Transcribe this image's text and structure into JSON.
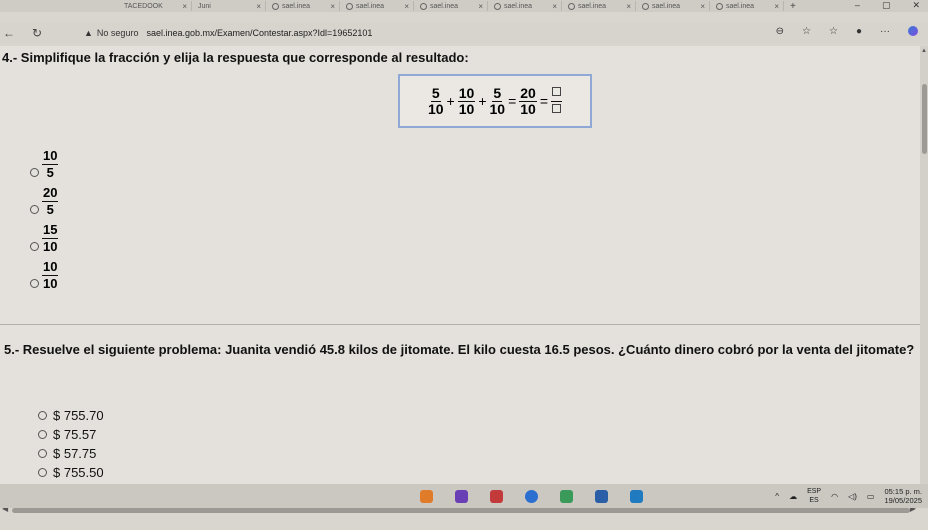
{
  "browser": {
    "tabs": [
      {
        "label": "TACEDOOK"
      },
      {
        "label": "Juni"
      },
      {
        "label": "sael.inea"
      },
      {
        "label": "sael.inea"
      },
      {
        "label": "sael.inea"
      },
      {
        "label": "sael.inea"
      },
      {
        "label": "sael.inea"
      },
      {
        "label": "sael.inea"
      },
      {
        "label": "sael.inea"
      }
    ],
    "security_label": "No seguro",
    "url": "sael.inea.gob.mx/Examen/Contestar.aspx?Idl=19652101"
  },
  "q4": {
    "title": "4.- Simplifique la fracción y elija la respuesta que corresponde al resultado:",
    "equation": {
      "terms": [
        {
          "num": "5",
          "den": "10"
        },
        {
          "num": "10",
          "den": "10"
        },
        {
          "num": "5",
          "den": "10"
        },
        {
          "num": "20",
          "den": "10"
        }
      ],
      "plus": "+",
      "equals": "="
    },
    "options": [
      {
        "num": "10",
        "den": "5"
      },
      {
        "num": "20",
        "den": "5"
      },
      {
        "num": "15",
        "den": "10"
      },
      {
        "num": "10",
        "den": "10"
      }
    ]
  },
  "q5": {
    "title": "5.- Resuelve el siguiente problema: Juanita vendió 45.8 kilos de jitomate. El kilo cuesta 16.5 pesos. ¿Cuánto dinero cobró por la venta del jitomate?",
    "options": [
      "$ 755.70",
      "$ 75.57",
      "$ 57.75",
      "$ 755.50"
    ]
  },
  "taskbar": {
    "lang_top": "ESP",
    "lang_bottom": "ES",
    "time": "05:15 p. m.",
    "date": "19/05/2025"
  }
}
